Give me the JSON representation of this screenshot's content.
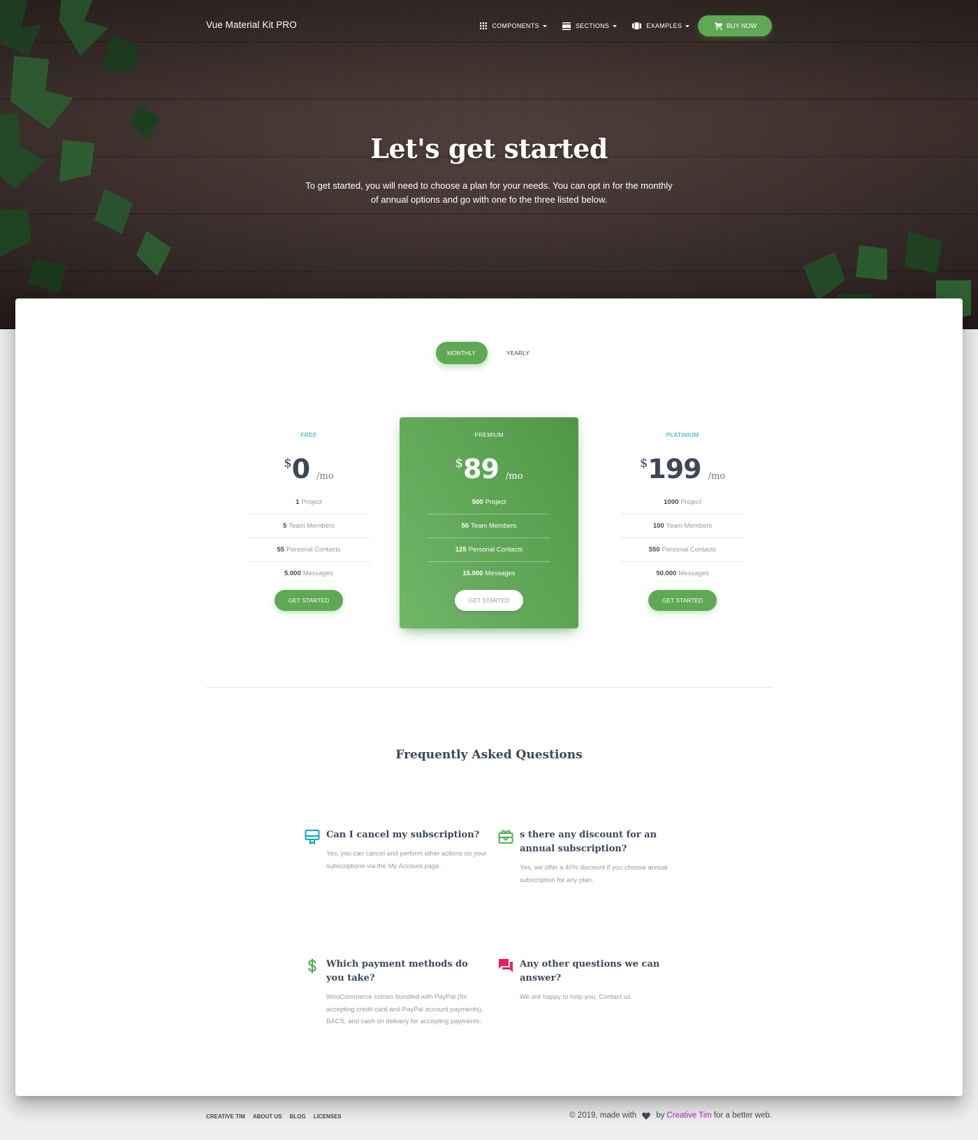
{
  "nav": {
    "brand": "Vue Material Kit PRO",
    "items": [
      {
        "label": "Components",
        "icon": "apps-icon"
      },
      {
        "label": "Sections",
        "icon": "view-day-icon"
      },
      {
        "label": "Examples",
        "icon": "view-carousel-icon"
      }
    ],
    "buy_label": "Buy Now",
    "buy_icon": "shopping-cart-icon"
  },
  "hero": {
    "title": "Let's get started",
    "subtitle": "To get started, you will need to choose a plan for your needs. You can opt in for the monthly of annual options and go with one fo the three listed below."
  },
  "toggle": {
    "options": [
      "Monthly",
      "Yearly"
    ],
    "active": "Monthly"
  },
  "plans": [
    {
      "category": "Free",
      "currency": "$",
      "amount": "0",
      "period": "/mo",
      "features": [
        {
          "value": "1",
          "label": "Project"
        },
        {
          "value": "5",
          "label": "Team Members"
        },
        {
          "value": "55",
          "label": "Personal Contacts"
        },
        {
          "value": "5.000",
          "label": "Messages"
        }
      ],
      "cta": "Get Started"
    },
    {
      "category": "Premium",
      "currency": "$",
      "amount": "89",
      "period": "/mo",
      "features": [
        {
          "value": "500",
          "label": "Project"
        },
        {
          "value": "50",
          "label": "Team Members"
        },
        {
          "value": "125",
          "label": "Personal Contacts"
        },
        {
          "value": "15.000",
          "label": "Messages"
        }
      ],
      "cta": "Get Started"
    },
    {
      "category": "Platinium",
      "currency": "$",
      "amount": "199",
      "period": "/mo",
      "features": [
        {
          "value": "1000",
          "label": "Project"
        },
        {
          "value": "100",
          "label": "Team Members"
        },
        {
          "value": "550",
          "label": "Personal Contacts"
        },
        {
          "value": "50.000",
          "label": "Messages"
        }
      ],
      "cta": "Get Started"
    }
  ],
  "faq": {
    "title": "Frequently Asked Questions",
    "items": [
      {
        "icon": "card-membership-icon",
        "question": "Can I cancel my subscription?",
        "answer": "Yes, you can cancel and perform other actions on your subscriptions via the My Account page."
      },
      {
        "icon": "card-giftcard-icon",
        "question": "s there any discount for an annual subscription?",
        "answer": "Yes, we offer a 40% discount if you choose annual subscription for any plan."
      },
      {
        "icon": "attach-money-icon",
        "question": "Which payment methods do you take?",
        "answer": "WooCommerce comes bundled with PayPal (for accepting credit card and PayPal account payments), BACS, and cash on delivery for accepting payments."
      },
      {
        "icon": "question-answer-icon",
        "question": "Any other questions we can answer?",
        "answer": "We are happy to help you. Contact us."
      }
    ]
  },
  "footer": {
    "links": [
      "Creative Tim",
      "About Us",
      "Blog",
      "Licenses"
    ],
    "copyright_prefix": "© 2019, made with",
    "copyright_by": "by",
    "copyright_author": "Creative Tim",
    "copyright_suffix": "for a better web."
  },
  "colors": {
    "accent_green": "#5fa854",
    "category_cyan": "#00acc1",
    "faq_icon_cyan": "#00acc1",
    "faq_icon_green": "#4caf50",
    "faq_icon_pink": "#e91e63",
    "link_purple": "#9c27b0"
  }
}
